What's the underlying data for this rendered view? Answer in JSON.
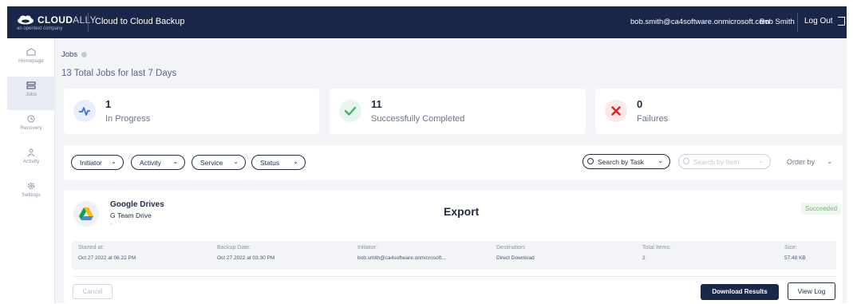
{
  "topbar": {
    "logo_text_bold": "CLOUD",
    "logo_text_light": "ALLY",
    "logo_subtitle": "an opentext company",
    "app_title": "Cloud to Cloud Backup",
    "user_email": "bob.smith@ca4software.onmicrosoft.com",
    "user_name": "Bob Smith",
    "logout_label": "Log Out"
  },
  "sidebar": {
    "items": [
      {
        "label": "Homepage",
        "icon": "home-icon",
        "active": false
      },
      {
        "label": "Jobs",
        "icon": "jobs-icon",
        "active": true
      },
      {
        "label": "Recovery",
        "icon": "recovery-icon",
        "active": false
      },
      {
        "label": "Activity",
        "icon": "activity-icon",
        "active": false
      },
      {
        "label": "Settings",
        "icon": "gear-icon",
        "active": false
      }
    ]
  },
  "page": {
    "breadcrumb": "Jobs",
    "summary": "13 Total Jobs for last 7 Days"
  },
  "stats": [
    {
      "count": "1",
      "label": "In Progress",
      "icon": "pulse-icon",
      "color": "#3a6ee8"
    },
    {
      "count": "11",
      "label": "Successfully Completed",
      "icon": "check-icon",
      "color": "#3cb371"
    },
    {
      "count": "0",
      "label": "Failures",
      "icon": "x-icon",
      "color": "#e02424"
    }
  ],
  "filters": {
    "pills": [
      "Initiator",
      "Activity",
      "Service",
      "Status"
    ],
    "search_task_placeholder": "Search by Task",
    "search_item_placeholder": "Search by Item",
    "order_by_label": "Order by"
  },
  "job": {
    "service": "Google Drives",
    "account": "G Team Drive",
    "tiny_text": "-",
    "type": "Export",
    "status": "Succeeded",
    "details": [
      {
        "label": "Started at:",
        "value": "Oct 27 2022 at 06:22 PM"
      },
      {
        "label": "Backup Date:",
        "value": "Oct 27 2022 at 03:30 PM"
      },
      {
        "label": "Initiator:",
        "value": "bob.smith@ca4software.onmicrosoft..."
      },
      {
        "label": "Destination:",
        "value": "Direct Download"
      },
      {
        "label": "Total Items:",
        "value": "2"
      },
      {
        "label": "Size:",
        "value": "57.48 KB"
      }
    ],
    "cancel_label": "Cancel",
    "download_label": "Download Results",
    "viewlog_label": "View Log"
  },
  "colors": {
    "navy": "#1b2749",
    "background": "#f3f4f8",
    "success": "#3cb371",
    "failure": "#e02424",
    "progress": "#3a6ee8"
  }
}
